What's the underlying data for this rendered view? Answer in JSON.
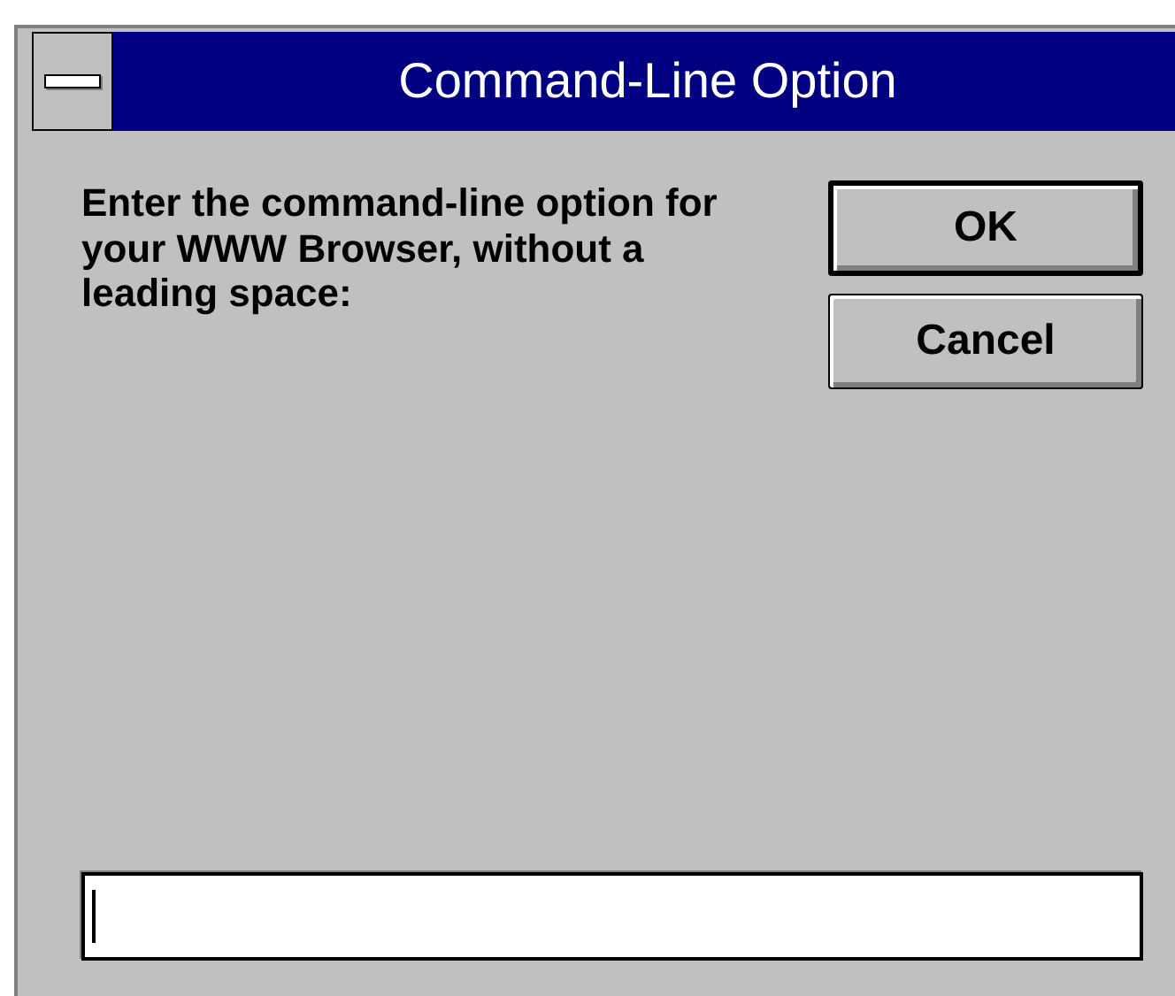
{
  "window": {
    "title": "Command-Line Option"
  },
  "prompt": "Enter the command-line option for your WWW Browser, without a leading space:",
  "buttons": [
    {
      "label": "OK",
      "default": true
    },
    {
      "label": "Cancel",
      "default": false
    }
  ],
  "input": {
    "focused": true
  }
}
